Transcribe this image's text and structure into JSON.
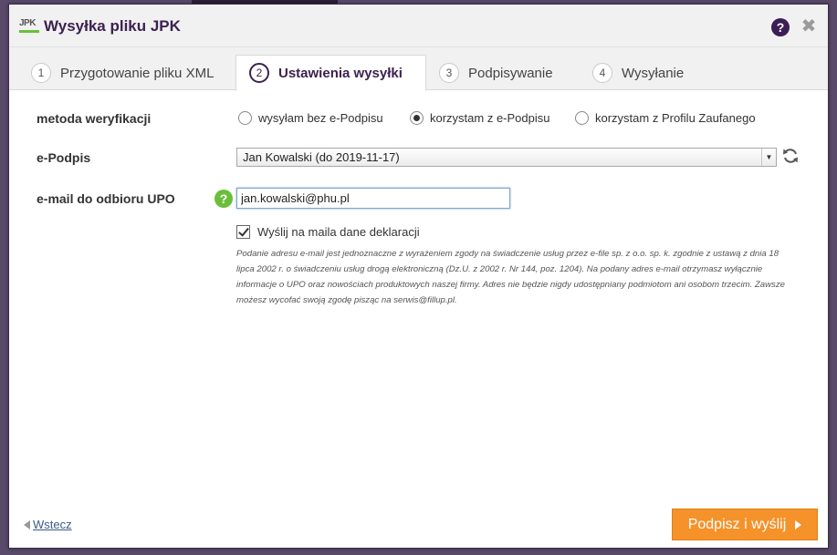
{
  "dialog": {
    "logo_text": "JPK",
    "title": "Wysyłka pliku JPK",
    "help": "?",
    "close": "✖"
  },
  "tabs": [
    {
      "num": "1",
      "label": "Przygotowanie pliku XML"
    },
    {
      "num": "2",
      "label": "Ustawienia wysyłki"
    },
    {
      "num": "3",
      "label": "Podpisywanie"
    },
    {
      "num": "4",
      "label": "Wysyłanie"
    }
  ],
  "form": {
    "verification_label": "metoda weryfikacji",
    "verification_options": [
      {
        "label": "wysyłam bez e-Podpisu"
      },
      {
        "label": "korzystam z e-Podpisu"
      },
      {
        "label": "korzystam z Profilu Zaufanego"
      }
    ],
    "verification_selected": 1,
    "epodpis_label": "e-Podpis",
    "epodpis_value": "Jan Kowalski (do 2019-11-17)",
    "email_label": "e-mail do odbioru UPO",
    "email_help": "?",
    "email_value": "jan.kowalski@phu.pl",
    "checkbox_label": "Wyślij na maila dane deklaracji",
    "checkbox_checked": true,
    "disclaimer": "Podanie adresu e-mail jest jednoznaczne z wyrażeniem zgody na świadczenie usług przez e-file sp. z o.o. sp. k. zgodnie z ustawą z dnia 18 lipca 2002 r. o świadczeniu usług drogą elektroniczną (Dz.U. z 2002 r. Nr 144, poz. 1204).  Na podany adres e-mail otrzymasz wyłącznie informacje o UPO oraz nowościach produktowych naszej firmy. Adres nie będzie nigdy udostępniany podmiotom ani osobom trzecim. Zawsze możesz wycofać swoją zgodę pisząc na serwis@fillup.pl."
  },
  "footer": {
    "back_label": "Wstecz",
    "submit_label": "Podpisz i wyślij"
  },
  "colors": {
    "accent": "#3d2150",
    "submit": "#f5922a",
    "help_green": "#6abf3a"
  }
}
